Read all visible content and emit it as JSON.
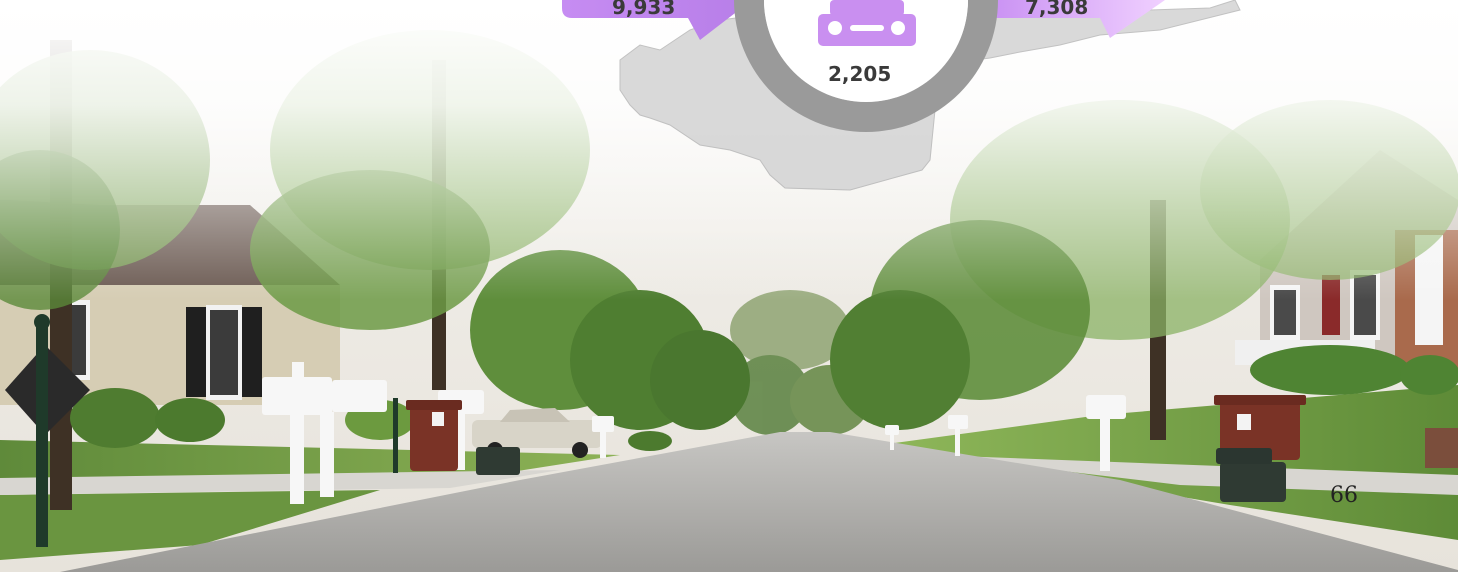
{
  "infographic": {
    "left_value": "9,933",
    "center_value": "2,205",
    "right_value": "7,308",
    "center_icon": "car-icon",
    "accent_color": "#c98ff0",
    "ring_color": "#9a9a9a",
    "map_color": "#d9d9d9"
  },
  "footer": {
    "page_number": "66"
  },
  "photo": {
    "description_icon": "street-photo"
  }
}
